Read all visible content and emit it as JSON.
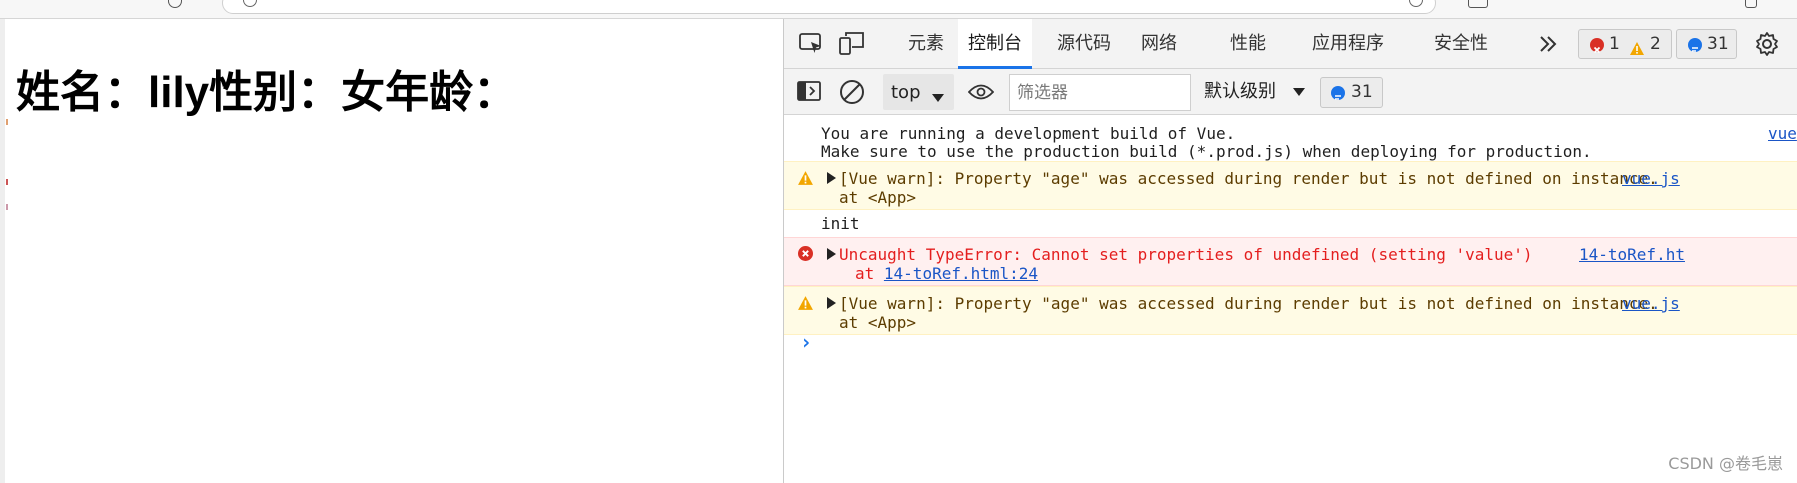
{
  "page": {
    "heading": "姓名：lily性别：女年龄："
  },
  "devtools": {
    "tabs": [
      {
        "label": "元素"
      },
      {
        "label": "控制台",
        "active": true
      },
      {
        "label": "源代码"
      },
      {
        "label": "网络"
      },
      {
        "label": "性能"
      },
      {
        "label": "应用程序"
      },
      {
        "label": "安全性"
      }
    ],
    "more_tabs_icon": "double-chevron-right",
    "issues": {
      "errors": "1",
      "warnings": "2",
      "messages": "31"
    },
    "toolbar": {
      "context": "top",
      "filter_placeholder": "筛选器",
      "level": "默认级别",
      "message_count": "31"
    },
    "console": {
      "info1": {
        "line1": "You are running a development build of Vue.",
        "line2": "Make sure to use the production build (*.prod.js) when deploying for production.",
        "source": "vue"
      },
      "warn1": {
        "line1": "[Vue warn]: Property \"age\" was accessed during render but is not defined on instance.",
        "line2": "at <App>",
        "source": "vue.js"
      },
      "log1": {
        "text": "init"
      },
      "error1": {
        "line1": "Uncaught TypeError: Cannot set properties of undefined (setting 'value')",
        "line2_prefix": "at ",
        "line2_link": "14-toRef.html:24",
        "source": "14-toRef.ht"
      },
      "warn2": {
        "line1": "[Vue warn]: Property \"age\" was accessed during render but is not defined on instance.",
        "line2": "at <App>",
        "source": "vue.js"
      },
      "prompt": "›"
    }
  },
  "colors": {
    "accent": "#1a73e8",
    "warn_bg": "#fffbe5",
    "error_bg": "#fff0f0",
    "error_text": "#e41e1e",
    "link": "#1a55c6"
  },
  "watermark": "CSDN @卷毛崽"
}
